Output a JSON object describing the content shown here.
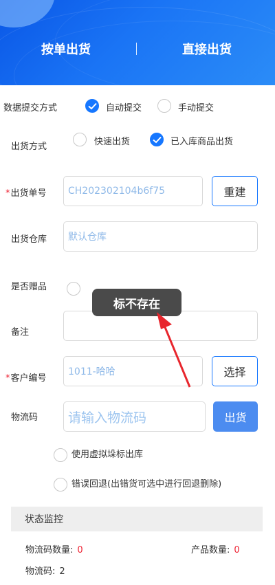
{
  "tabs": [
    {
      "label": "按单出货"
    },
    {
      "label": "直接出货"
    }
  ],
  "submit_mode": {
    "label": "数据提交方式",
    "options": [
      {
        "label": "自动提交",
        "checked": true
      },
      {
        "label": "手动提交",
        "checked": false
      }
    ]
  },
  "ship_mode": {
    "label": "出货方式",
    "options": [
      {
        "label": "快速出货",
        "checked": false
      },
      {
        "label": "已入库商品出货",
        "checked": true
      }
    ]
  },
  "order_no": {
    "required_mark": "*",
    "label": "出货单号",
    "value": "CH202302104b6f75",
    "rebuild_button": "重建"
  },
  "warehouse": {
    "label": "出货仓库",
    "value": "默认仓库"
  },
  "gift": {
    "label": "是否赠品"
  },
  "remark": {
    "label": "备注",
    "value": ""
  },
  "customer": {
    "required_mark": "*",
    "label": "客户编号",
    "value": "1011-哈哈",
    "select_button": "选择"
  },
  "logistics": {
    "label": "物流码",
    "placeholder": "请输入物流码",
    "ship_button": "出货"
  },
  "virtual_label_option": "使用虚拟垛标出库",
  "rollback_option": "错误回退(出错货可选中进行回退删除)",
  "toast": "标不存在",
  "status": {
    "title": "状态监控",
    "logistics_count_label": "物流码数量:",
    "logistics_count": "0",
    "product_count_label": "产品数量:",
    "product_count": "0",
    "logistics_code_label": "物流码:",
    "logistics_code_value": "2"
  },
  "colors": {
    "primary": "#1677ff",
    "required": "#ee2233",
    "toast_bg": "#4a4a4a",
    "arrow": "#e8262d"
  }
}
